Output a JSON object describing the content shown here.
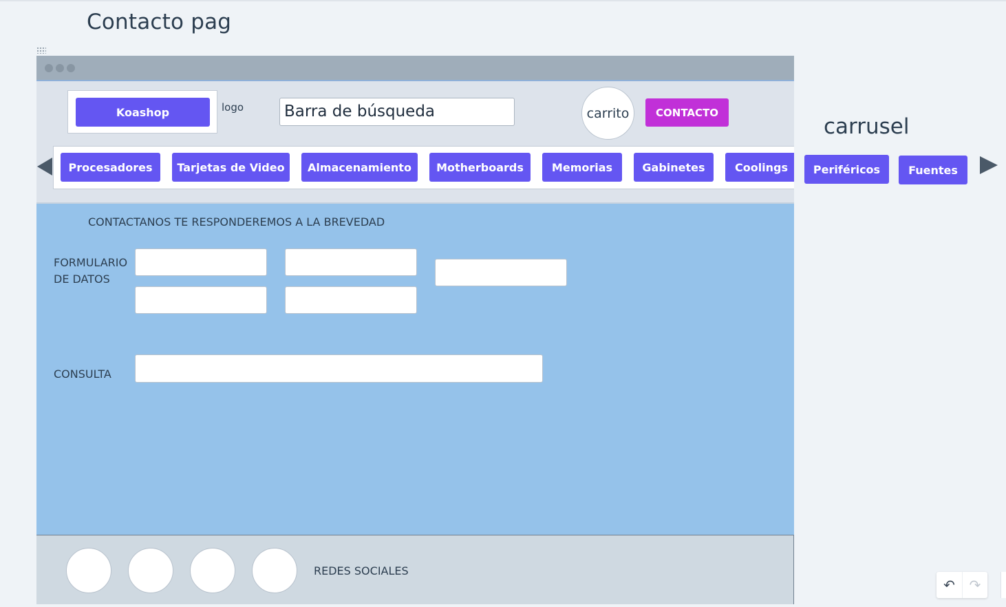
{
  "page": {
    "title": "Contacto pag"
  },
  "header": {
    "brand_button": "Koashop",
    "logo_label": "logo",
    "search_text": "Barra de búsqueda",
    "cart_label": "carrito",
    "contact_button": "CONTACTO"
  },
  "nav": {
    "categories": [
      "Procesadores",
      "Tarjetas de Video",
      "Almacenamiento",
      "Motherboards",
      "Memorias",
      "Gabinetes",
      "Coolings",
      "Periféricos",
      "Fuentes"
    ],
    "carousel_label": "carrusel"
  },
  "content": {
    "title": "CONTACTANOS TE RESPONDEREMOS A LA BREVEDAD",
    "form_label": "FORMULARIO\nDE DATOS",
    "form_label_line1": "FORMULARIO",
    "form_label_line2": "DE DATOS",
    "query_label": "CONSULTA"
  },
  "footer": {
    "social_label": "REDES SOCIALES"
  },
  "toolbar": {
    "undo_icon": "↶",
    "redo_icon": "↷"
  },
  "colors": {
    "button": "#6456f2",
    "contact": "#c130d8",
    "content_bg": "#95c2ea",
    "footer_bg": "#cfd9e1"
  }
}
